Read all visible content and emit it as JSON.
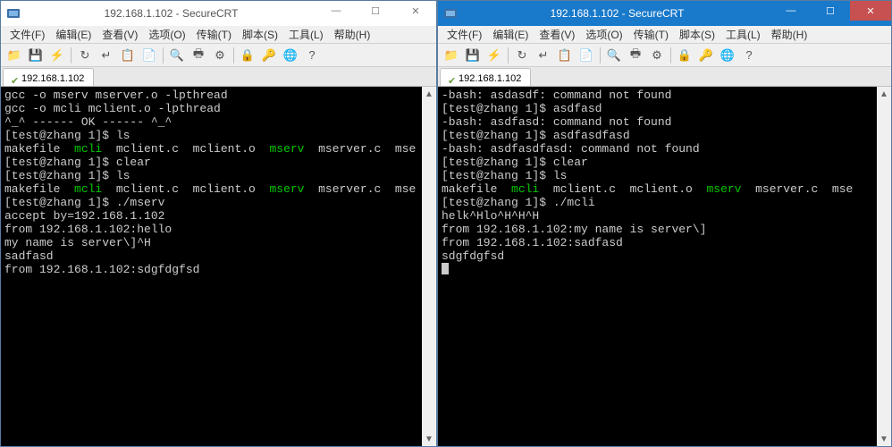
{
  "windows": [
    {
      "title": "192.168.1.102 - SecureCRT",
      "menubar": [
        "文件(F)",
        "编辑(E)",
        "查看(V)",
        "选项(O)",
        "传输(T)",
        "脚本(S)",
        "工具(L)",
        "帮助(H)"
      ],
      "tab": "192.168.1.102",
      "terminal_lines": [
        {
          "segments": [
            {
              "t": "gcc -o mserv mserver.o -lpthread"
            }
          ]
        },
        {
          "segments": [
            {
              "t": "gcc -o mcli mclient.o -lpthread"
            }
          ]
        },
        {
          "segments": [
            {
              "t": "^_^ ------ OK ------ ^_^"
            }
          ]
        },
        {
          "segments": [
            {
              "t": "[test@zhang 1]$ ls"
            }
          ]
        },
        {
          "segments": [
            {
              "t": "makefile  "
            },
            {
              "t": "mcli",
              "c": "green"
            },
            {
              "t": "  mclient.c  mclient.o  "
            },
            {
              "t": "mserv",
              "c": "green"
            },
            {
              "t": "  mserver.c  mse"
            }
          ]
        },
        {
          "segments": [
            {
              "t": "[test@zhang 1]$ clear"
            }
          ]
        },
        {
          "segments": [
            {
              "t": ""
            }
          ]
        },
        {
          "segments": [
            {
              "t": "[test@zhang 1]$ ls"
            }
          ]
        },
        {
          "segments": [
            {
              "t": "makefile  "
            },
            {
              "t": "mcli",
              "c": "green"
            },
            {
              "t": "  mclient.c  mclient.o  "
            },
            {
              "t": "mserv",
              "c": "green"
            },
            {
              "t": "  mserver.c  mse"
            }
          ]
        },
        {
          "segments": [
            {
              "t": "[test@zhang 1]$ ./mserv"
            }
          ]
        },
        {
          "segments": [
            {
              "t": "accept by=192.168.1.102"
            }
          ]
        },
        {
          "segments": [
            {
              "t": "from 192.168.1.102:hello"
            }
          ]
        },
        {
          "segments": [
            {
              "t": "my name is server\\]^H"
            }
          ]
        },
        {
          "segments": [
            {
              "t": "sadfasd"
            }
          ]
        },
        {
          "segments": [
            {
              "t": "from 192.168.1.102:sdgfdgfsd"
            }
          ]
        }
      ]
    },
    {
      "title": "192.168.1.102 - SecureCRT",
      "menubar": [
        "文件(F)",
        "编辑(E)",
        "查看(V)",
        "选项(O)",
        "传输(T)",
        "脚本(S)",
        "工具(L)",
        "帮助(H)"
      ],
      "tab": "192.168.1.102",
      "terminal_lines": [
        {
          "segments": [
            {
              "t": "-bash: asdasdf: command not found"
            }
          ]
        },
        {
          "segments": [
            {
              "t": "[test@zhang 1]$ asdfasd"
            }
          ]
        },
        {
          "segments": [
            {
              "t": "-bash: asdfasd: command not found"
            }
          ]
        },
        {
          "segments": [
            {
              "t": "[test@zhang 1]$ asdfasdfasd"
            }
          ]
        },
        {
          "segments": [
            {
              "t": "-bash: asdfasdfasd: command not found"
            }
          ]
        },
        {
          "segments": [
            {
              "t": "[test@zhang 1]$ clear"
            }
          ]
        },
        {
          "segments": [
            {
              "t": ""
            }
          ]
        },
        {
          "segments": [
            {
              "t": "[test@zhang 1]$ ls"
            }
          ]
        },
        {
          "segments": [
            {
              "t": "makefile  "
            },
            {
              "t": "mcli",
              "c": "green"
            },
            {
              "t": "  mclient.c  mclient.o  "
            },
            {
              "t": "mserv",
              "c": "green"
            },
            {
              "t": "  mserver.c  mse"
            }
          ]
        },
        {
          "segments": [
            {
              "t": "[test@zhang 1]$ ./mcli"
            }
          ]
        },
        {
          "segments": [
            {
              "t": "helk^Hlo^H^H^H"
            }
          ]
        },
        {
          "segments": [
            {
              "t": "from 192.168.1.102:my name is server\\]"
            }
          ]
        },
        {
          "segments": [
            {
              "t": "from 192.168.1.102:sadfasd"
            }
          ]
        },
        {
          "segments": [
            {
              "t": "sdgfdgfsd"
            }
          ]
        }
      ]
    }
  ],
  "winbtns": {
    "min": "—",
    "max": "☐",
    "close": "✕"
  },
  "toolbar_icons": [
    "folder-icon",
    "disk-icon",
    "lightning-icon",
    "refresh-icon",
    "enter-icon",
    "copy-icon",
    "paste-icon",
    "search-icon",
    "print-icon",
    "settings-icon",
    "lock-icon",
    "key-icon",
    "globe-icon",
    "help-icon"
  ]
}
